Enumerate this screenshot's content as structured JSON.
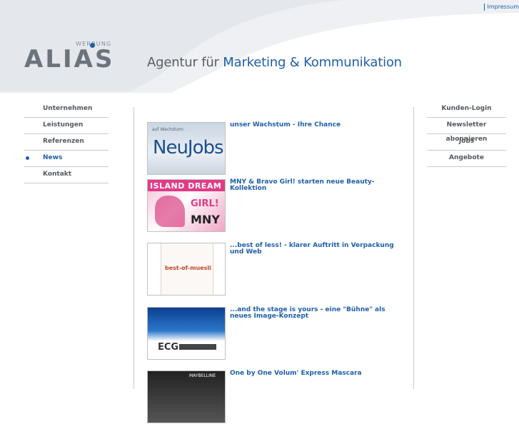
{
  "header": {
    "impressum": "Impressum",
    "logo_word": "ALIAS",
    "logo_sub": "WERBUNG",
    "tagline_prefix": "Agentur für ",
    "tagline_highlight": "Marketing & Kommunikation"
  },
  "left_nav": [
    {
      "label": "Unternehmen",
      "active": false
    },
    {
      "label": "Leistungen",
      "active": false
    },
    {
      "label": "Referenzen",
      "active": false
    },
    {
      "label": "News",
      "active": true
    },
    {
      "label": "Kontakt",
      "active": false
    }
  ],
  "right_nav": [
    {
      "label": "Kunden-Login"
    },
    {
      "label": "Newsletter abonnieren"
    },
    {
      "label": "Jobs"
    },
    {
      "label": "Angebote"
    }
  ],
  "news": [
    {
      "title": "unser Wachstum - Ihre Chance",
      "thumb_small": "auf Wachstum:",
      "thumb_big": "NeuJobs"
    },
    {
      "title": "MNY & Bravo Girl! starten neue Beauty-Kollektion",
      "thumb_head": "ISLAND DREAM",
      "thumb_girl": "GIRL!",
      "thumb_mny": "MNY"
    },
    {
      "title": "...best of less! - klarer Auftritt in Verpackung und Web",
      "thumb_label": "best-of-muesli"
    },
    {
      "title": "...and the stage is yours - eine \"Bühne\" als neues Image-Konzept",
      "thumb_label": "ECG"
    },
    {
      "title": "One by One Volum' Express Mascara",
      "thumb_label": "MAYBELLINE"
    }
  ],
  "colors": {
    "accent": "#1f5fa8",
    "nav_text": "#55595f",
    "divider": "#c9c9c9"
  }
}
